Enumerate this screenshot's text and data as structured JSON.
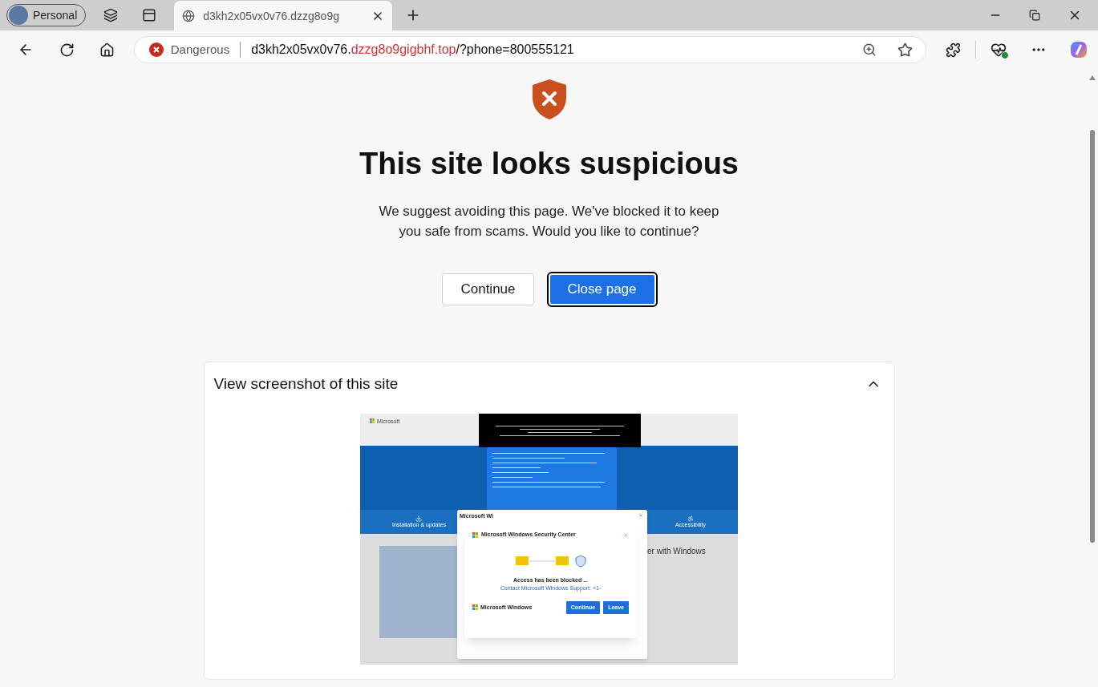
{
  "browser": {
    "profile": "Personal",
    "tab": {
      "title": "d3kh2x05vx0v76.dzzg8o9g"
    },
    "address": {
      "security": "Dangerous",
      "host": "d3kh2x05vx0v76.",
      "domain": "dzzg8o9gigbhf.top",
      "path": "/?phone=800555121"
    }
  },
  "warning": {
    "title": "This site looks suspicious",
    "message": "We suggest avoiding this page. We've blocked it to keep you safe from scams. Would you like to continue?",
    "buttons": [
      {
        "label": "Continue",
        "kind": "secondary"
      },
      {
        "label": "Close page",
        "kind": "primary"
      }
    ]
  },
  "screenshot_panel": {
    "title": "View screenshot of this site",
    "expanded": true,
    "preview": {
      "site_logo": "Microsoft",
      "nav": [
        "Installation & updates",
        "Accessibility"
      ],
      "heading_fragment": "er with Windows",
      "window_title": "Microsoft Wi",
      "dialog": {
        "title": "Microsoft Windows Security Center",
        "status": "Access has been blocked ...",
        "contact": "Contact Microsoft Windows Support: +1-",
        "footer": "Microsoft Windows",
        "buttons": [
          "Continue",
          "Leave"
        ]
      }
    }
  }
}
